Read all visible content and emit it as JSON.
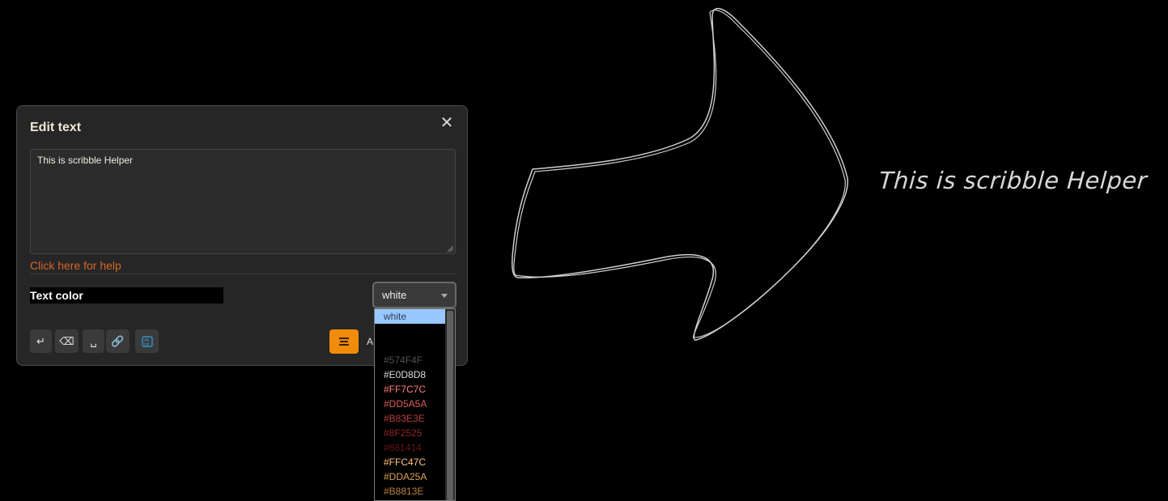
{
  "canvas": {
    "text": "This is scribble Helper"
  },
  "dialog": {
    "title": "Edit text",
    "close_icon": "close-icon",
    "textarea_value": "This is scribble Helper",
    "help_link": "Click here for help",
    "text_color_label": "Text color",
    "color_select_value": "white",
    "toolbar_icons": [
      "enter-icon",
      "backspace-icon",
      "space-icon",
      "link-icon",
      "abcd-icon"
    ],
    "align_icon": "align-center-icon",
    "partial_label": "A"
  },
  "dropdown": {
    "options": [
      {
        "label": "white",
        "color": "#2e3f5a",
        "selected": true
      },
      {
        "label": "",
        "color": "#000000"
      },
      {
        "label": "",
        "color": "#000000"
      },
      {
        "label": "#574F4F",
        "color": "#574F4F"
      },
      {
        "label": "#E0D8D8",
        "color": "#E0D8D8"
      },
      {
        "label": "#FF7C7C",
        "color": "#FF7C7C"
      },
      {
        "label": "#DD5A5A",
        "color": "#DD5A5A"
      },
      {
        "label": "#B83E3E",
        "color": "#B83E3E"
      },
      {
        "label": "#8F2525",
        "color": "#8F2525"
      },
      {
        "label": "#681414",
        "color": "#681414"
      },
      {
        "label": "#FFC47C",
        "color": "#FFC47C"
      },
      {
        "label": "#DDA25A",
        "color": "#DDA25A"
      },
      {
        "label": "#B8813E",
        "color": "#B8813E"
      }
    ]
  },
  "colors": {
    "accent": "#F28A0A",
    "help_link": "#D4662A",
    "selected_option_bg": "#99C7FF"
  }
}
